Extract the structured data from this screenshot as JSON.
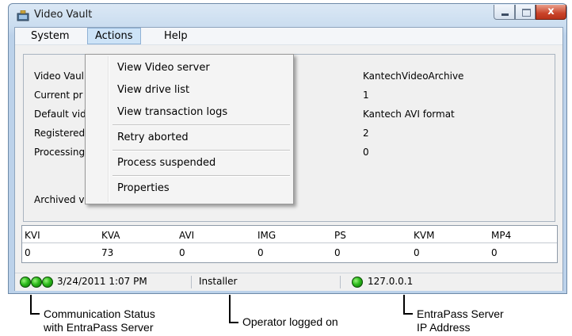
{
  "window": {
    "title": "Video Vault",
    "close_glyph": "x"
  },
  "menu": {
    "system": "System",
    "actions": "Actions",
    "help": "Help"
  },
  "dropdown": {
    "items": [
      "View Video server",
      "View drive list",
      "View transaction logs",
      "Retry aborted",
      "Process suspended",
      "Properties"
    ]
  },
  "info": {
    "labels": [
      "Video Vaul",
      "Current pr",
      "Default vid",
      "Registered",
      "Processing"
    ],
    "values": [
      "KantechVideoArchive",
      "1",
      "Kantech AVI format",
      "2",
      "0"
    ],
    "archived_label": "Archived video files"
  },
  "table": {
    "headers": [
      "KVI",
      "KVA",
      "AVI",
      "IMG",
      "PS",
      "KVM",
      "MP4"
    ],
    "values": [
      "0",
      "73",
      "0",
      "0",
      "0",
      "0",
      "0"
    ]
  },
  "status": {
    "datetime": "3/24/2011 1:07 PM",
    "operator": "Installer",
    "ip": "127.0.0.1",
    "led_color": "#2dbb1c"
  },
  "callouts": {
    "comm_line1": "Communication Status",
    "comm_line2": "with EntraPass Server",
    "operator": "Operator logged on",
    "server_line1": "EntraPass Server",
    "server_line2": "IP Address"
  }
}
